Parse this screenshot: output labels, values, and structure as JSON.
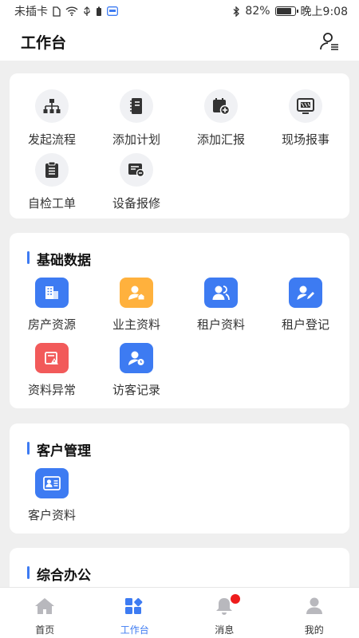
{
  "status_bar": {
    "carrier": "未插卡",
    "battery": "82%",
    "time": "晚上9:08"
  },
  "header": {
    "title": "工作台",
    "profile_icon": "user-list-icon"
  },
  "quick_actions": [
    {
      "label": "发起流程",
      "icon": "flowchart-icon"
    },
    {
      "label": "添加计划",
      "icon": "notebook-icon"
    },
    {
      "label": "添加汇报",
      "icon": "calendar-add-icon"
    },
    {
      "label": "现场报事",
      "icon": "monitor-report-icon"
    },
    {
      "label": "自检工单",
      "icon": "clipboard-icon"
    },
    {
      "label": "设备报修",
      "icon": "device-repair-icon"
    }
  ],
  "basic_data": {
    "title": "基础数据",
    "items": [
      {
        "label": "房产资源",
        "icon": "building-icon",
        "color": "#3d7bf2"
      },
      {
        "label": "业主资料",
        "icon": "owner-icon",
        "color": "#ffb13d"
      },
      {
        "label": "租户资料",
        "icon": "tenants-icon",
        "color": "#3d7bf2"
      },
      {
        "label": "租户登记",
        "icon": "tenant-register-icon",
        "color": "#3d7bf2"
      },
      {
        "label": "资料异常",
        "icon": "data-warning-icon",
        "color": "#f25a5a"
      },
      {
        "label": "访客记录",
        "icon": "visitor-record-icon",
        "color": "#3d7bf2"
      }
    ]
  },
  "customer": {
    "title": "客户管理",
    "items": [
      {
        "label": "客户资料",
        "icon": "customer-card-icon",
        "color": "#3d7bf2"
      }
    ]
  },
  "office": {
    "title": "综合办公"
  },
  "tabs": [
    {
      "label": "首页",
      "icon": "home-icon"
    },
    {
      "label": "工作台",
      "icon": "workbench-icon",
      "active": true
    },
    {
      "label": "消息",
      "icon": "bell-icon",
      "has_badge": true
    },
    {
      "label": "我的",
      "icon": "person-icon"
    }
  ]
}
